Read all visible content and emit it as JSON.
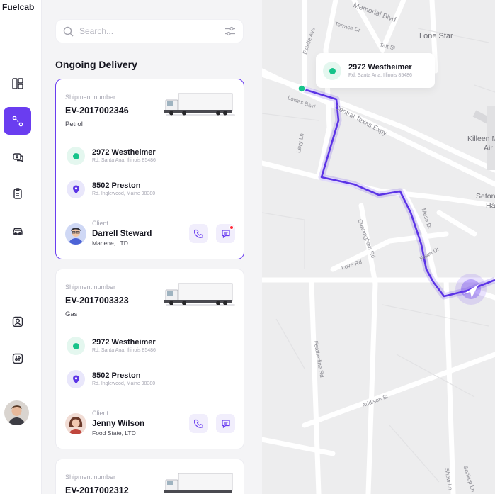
{
  "app": {
    "brand": "Fuelcab"
  },
  "sidebar": {
    "items": [
      {
        "icon": "dashboard-icon"
      },
      {
        "icon": "route-icon",
        "active": true
      },
      {
        "icon": "chat-icon"
      },
      {
        "icon": "clipboard-icon"
      },
      {
        "icon": "car-icon"
      },
      {
        "icon": "user-icon"
      },
      {
        "icon": "settings-icon"
      }
    ]
  },
  "search": {
    "placeholder": "Search..."
  },
  "section": {
    "title": "Ongoing Delivery"
  },
  "deliveries": [
    {
      "shipment_label": "Shipment number",
      "shipment_number": "EV-2017002346",
      "fuel": "Petrol",
      "from": {
        "title": "2972 Westheimer",
        "sub": "Rd. Santa Ana, Illinois 85486"
      },
      "to": {
        "title": "8502 Preston",
        "sub": "Rd. Inglewood, Maine 98380"
      },
      "client_label": "Client",
      "client_name": "Darrell Steward",
      "client_company": "Mariene, LTD",
      "has_notification": true
    },
    {
      "shipment_label": "Shipment number",
      "shipment_number": "EV-2017003323",
      "fuel": "Gas",
      "from": {
        "title": "2972 Westheimer",
        "sub": "Rd. Santa Ana, Illinois 85486"
      },
      "to": {
        "title": "8502 Preston",
        "sub": "Rd. Inglewood, Maine 98380"
      },
      "client_label": "Client",
      "client_name": "Jenny Wilson",
      "client_company": "Food State, LTD",
      "has_notification": false
    },
    {
      "shipment_label": "Shipment number",
      "shipment_number": "EV-2017002312"
    }
  ],
  "map": {
    "popup": {
      "title": "2972 Westheimer",
      "sub": "Rd. Santa Ana, Illinois 85486"
    },
    "streets": [
      "Terrace Dr",
      "Lone Star",
      "Taft St",
      "Estelle Ave",
      "Lowes Blvd",
      "Central Texas Expy",
      "Levy Ln",
      "Cunningham Rd",
      "Mesa Dr",
      "Love Rd",
      "Fawn Dr",
      "Featherline Rd",
      "Addison St",
      "Shaw Ln",
      "Sonkup Ln",
      "Memorial Blvd"
    ],
    "places": [
      "Killeen M",
      "Air",
      "Seton",
      "Ha"
    ]
  },
  "colors": {
    "accent": "#6a3df0",
    "green": "#17c38a",
    "route": "#5b33e6"
  }
}
